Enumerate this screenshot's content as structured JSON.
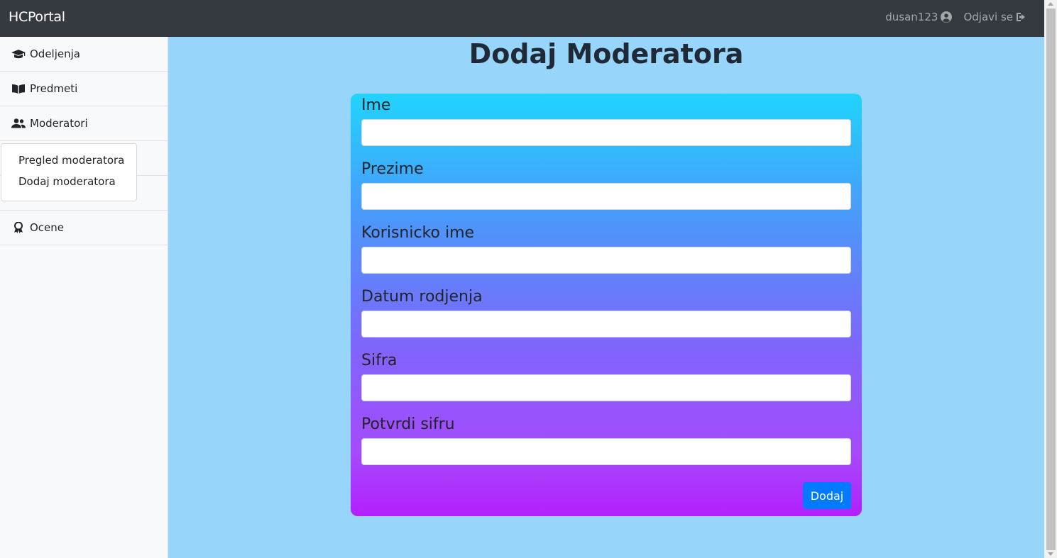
{
  "navbar": {
    "brand": "HCPortal",
    "user_label": "dusan123",
    "user_icon": "user-circle-icon",
    "logout_label": "Odjavi se",
    "logout_icon": "sign-out-icon"
  },
  "sidebar": {
    "items": [
      {
        "label": "Odeljenja",
        "icon": "graduation-cap-icon"
      },
      {
        "label": "Predmeti",
        "icon": "book-icon"
      },
      {
        "label": "Moderatori",
        "icon": "users-icon"
      },
      {
        "label": "",
        "icon": ""
      },
      {
        "label": "",
        "icon": ""
      },
      {
        "label": "Ocene",
        "icon": "award-icon"
      }
    ],
    "dropdown": [
      {
        "label": "Pregled moderatora"
      },
      {
        "label": "Dodaj moderatora"
      }
    ]
  },
  "main": {
    "title": "Dodaj Moderatora",
    "fields": [
      {
        "label": "Ime",
        "value": ""
      },
      {
        "label": "Prezime",
        "value": ""
      },
      {
        "label": "Korisnicko ime",
        "value": ""
      },
      {
        "label": "Datum rodjenja",
        "value": ""
      },
      {
        "label": "Sifra",
        "value": ""
      },
      {
        "label": "Potvrdi sifru",
        "value": ""
      }
    ],
    "submit_label": "Dodaj"
  },
  "colors": {
    "navbar_bg": "#343a40",
    "page_bg": "#97d5fb",
    "gradient_top": "#20d4fd",
    "gradient_bottom": "#b31ffd",
    "primary": "#007bff"
  }
}
